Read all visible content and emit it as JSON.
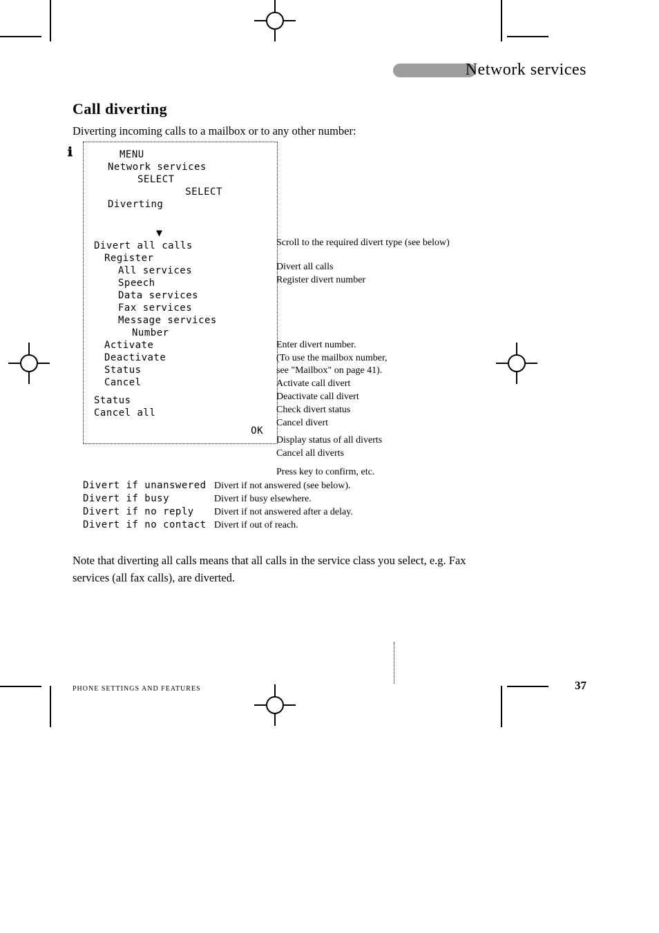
{
  "section": {
    "label": "Network services"
  },
  "heading": "Call diverting",
  "intro": "Diverting incoming calls to a mailbox or to any other number:",
  "menu": {
    "title": "MENU",
    "path1": "Network services",
    "select1": "SELECT",
    "path2": "Diverting",
    "select2": "SELECT",
    "arrow_hint": "Scroll to the required divert type (see below)",
    "divert_all": "Divert all calls",
    "register": "Register",
    "svc_all": "All services",
    "svc_speech": "Speech",
    "svc_data": "Data services",
    "svc_fax": "Fax services",
    "svc_msg": "Message services",
    "number": "Number",
    "activate": "Activate",
    "deactivate": "Deactivate",
    "status": "Status",
    "cancel": "Cancel",
    "status2": "Status",
    "cancel_all": "Cancel all",
    "ok": "OK",
    "ok_hint": "Press key to confirm, etc."
  },
  "col_desc": {
    "divert_all": "Divert all calls",
    "register": "Register divert number",
    "number_line1": "Enter divert number.",
    "number_line2": "(To use the mailbox number,",
    "number_line3": "see \"Mailbox\" on page 41).",
    "activate": "Activate call divert",
    "deactivate": "Deactivate call divert",
    "status": "Check divert status",
    "cancel": "Cancel divert",
    "status2": "Display status of all diverts",
    "cancel_all": "Cancel all diverts"
  },
  "types": {
    "unanswered": "Divert if unanswered",
    "busy": "Divert if busy",
    "noreply": "Divert if no reply",
    "nocontact": "Divert if no contact"
  },
  "types_desc": {
    "unanswered": "Divert if not answered (see below).",
    "busy": "Divert if busy elsewhere.",
    "noreply": "Divert if not answered after a delay.",
    "nocontact": "Divert if out of reach."
  },
  "note_para": "Note that diverting all calls means that all calls in the service class you select, e.g. Fax services (all fax calls), are diverted.",
  "footer": {
    "left": "PHONE SETTINGS AND FEATURES",
    "page": "37"
  }
}
